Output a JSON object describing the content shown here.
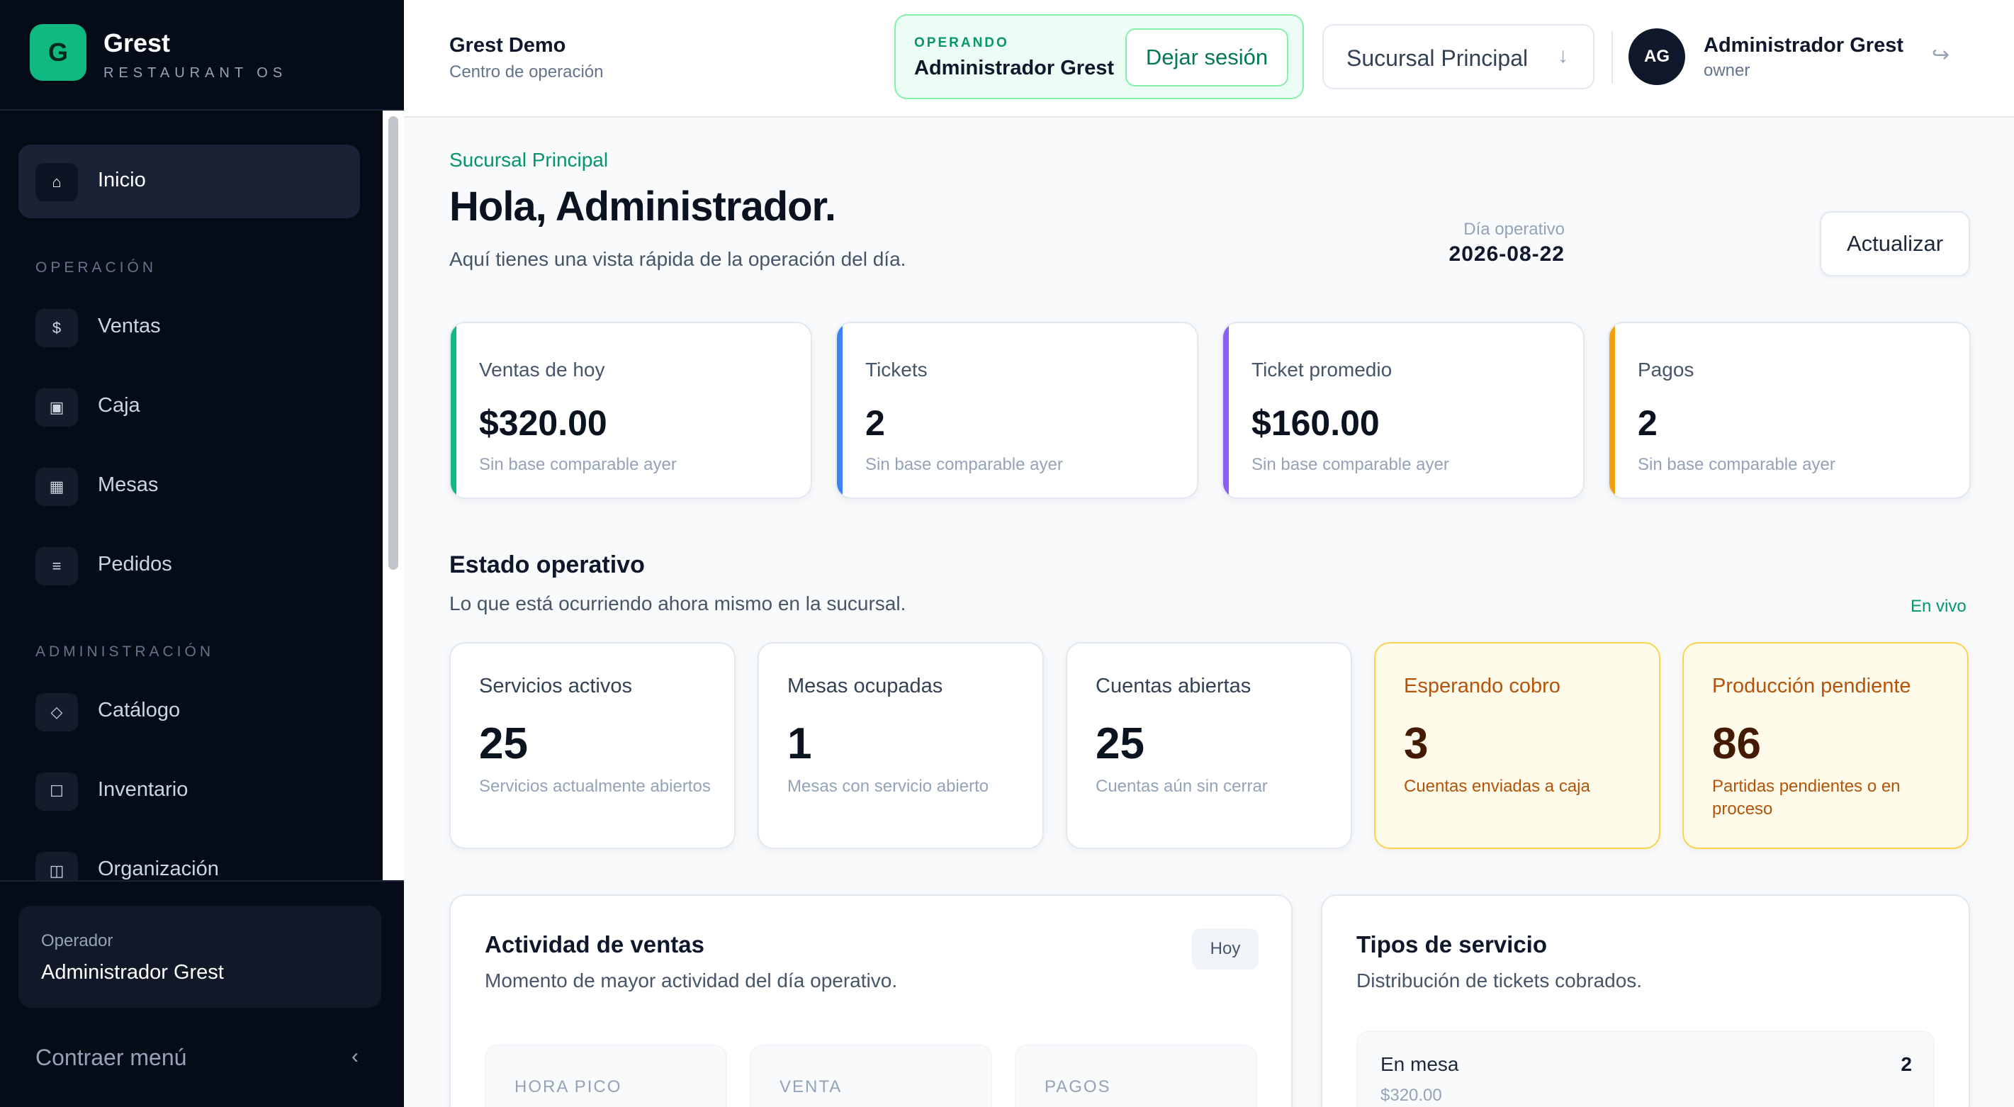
{
  "brand": {
    "logo_letter": "G",
    "name": "Grest",
    "tagline": "RESTAURANT OS"
  },
  "sidebar": {
    "home": {
      "label": "Inicio",
      "icon": "⌂"
    },
    "section_operation": "OPERACIÓN",
    "operation_items": [
      {
        "label": "Ventas",
        "icon": "$"
      },
      {
        "label": "Caja",
        "icon": "▣"
      },
      {
        "label": "Mesas",
        "icon": "▦"
      },
      {
        "label": "Pedidos",
        "icon": "≡"
      }
    ],
    "section_admin": "ADMINISTRACIÓN",
    "admin_items": [
      {
        "label": "Catálogo",
        "icon": "◇"
      },
      {
        "label": "Inventario",
        "icon": "☐"
      },
      {
        "label": "Organización",
        "icon": "◫"
      }
    ],
    "operator_label": "Operador",
    "operator_name": "Administrador Grest",
    "collapse_label": "Contraer menú",
    "collapse_icon": "‹"
  },
  "topbar": {
    "org_name": "Grest Demo",
    "org_sub": "Centro de operación",
    "operating_label": "OPERANDO",
    "operating_name": "Administrador Grest",
    "leave_label": "Dejar sesión",
    "branch_selected": "Sucursal Principal",
    "branch_arrow": "↓",
    "avatar_initials": "AG",
    "user_name": "Administrador Grest",
    "user_role": "owner",
    "logout_icon": "↪"
  },
  "main": {
    "branch_eyebrow": "Sucursal Principal",
    "greeting": "Hola, Administrador.",
    "greeting_sub": "Aquí tienes una vista rápida de la operación del día.",
    "day_label": "Día operativo",
    "day_value": "2026-08-22",
    "refresh_label": "Actualizar"
  },
  "kpis": [
    {
      "label": "Ventas de hoy",
      "value": "$320.00",
      "note": "Sin base comparable ayer",
      "color": "#10b981"
    },
    {
      "label": "Tickets",
      "value": "2",
      "note": "Sin base comparable ayer",
      "color": "#3b82f6"
    },
    {
      "label": "Ticket promedio",
      "value": "$160.00",
      "note": "Sin base comparable ayer",
      "color": "#8b5cf6"
    },
    {
      "label": "Pagos",
      "value": "2",
      "note": "Sin base comparable ayer",
      "color": "#f59e0b"
    }
  ],
  "status_section": {
    "title": "Estado operativo",
    "sub": "Lo que está ocurriendo ahora mismo en la sucursal.",
    "live": "En vivo"
  },
  "status_cards": [
    {
      "label": "Servicios activos",
      "value": "25",
      "note": "Servicios actualmente abiertos",
      "warn": false
    },
    {
      "label": "Mesas ocupadas",
      "value": "1",
      "note": "Mesas con servicio abierto",
      "warn": false
    },
    {
      "label": "Cuentas abiertas",
      "value": "25",
      "note": "Cuentas aún sin cerrar",
      "warn": false
    },
    {
      "label": "Esperando cobro",
      "value": "3",
      "note": "Cuentas enviadas a caja",
      "warn": true
    },
    {
      "label": "Producción pendiente",
      "value": "86",
      "note": "Partidas pendientes o en proceso",
      "warn": true
    }
  ],
  "sales_activity": {
    "title": "Actividad de ventas",
    "sub": "Momento de mayor actividad del día operativo.",
    "badge": "Hoy",
    "metrics": [
      "HORA PICO",
      "VENTA",
      "PAGOS"
    ]
  },
  "service_types": {
    "title": "Tipos de servicio",
    "sub": "Distribución de tickets cobrados.",
    "rows": [
      {
        "name": "En mesa",
        "count": "2",
        "amount": "$320.00"
      }
    ]
  }
}
